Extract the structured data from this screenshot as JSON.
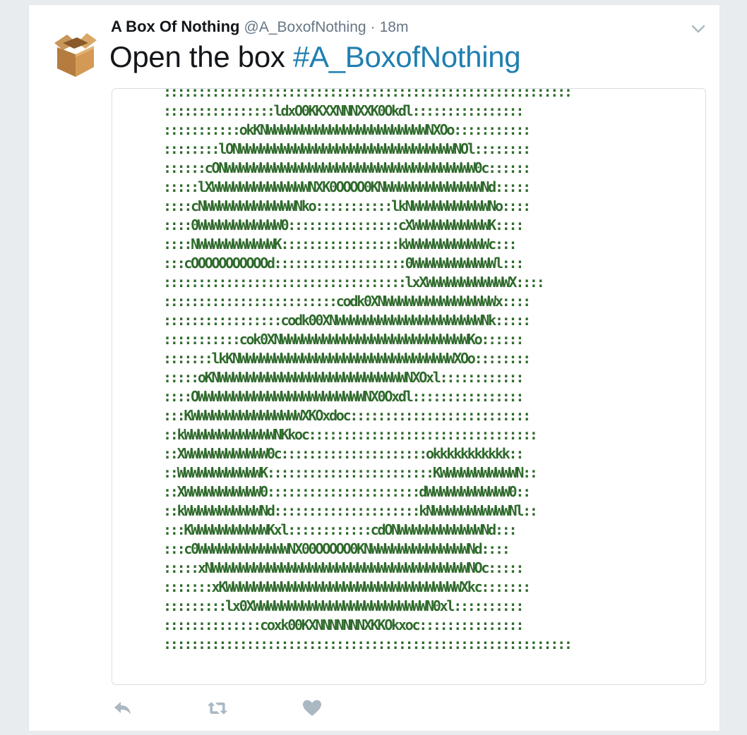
{
  "tweet": {
    "display_name": "A Box Of Nothing",
    "screen_name": "@A_BoxofNothing",
    "separator": "·",
    "timestamp": "18m",
    "text_prefix": "Open the box ",
    "hashtag": "#A_BoxofNothing",
    "ascii_art": ":::::::::::::::::::::::::::::::::::::::::::::::::::::::::::\n::::::::::::::::ldxO0KKXXNNNXXK0Okdl::::::::::::::::\n:::::::::::okKNWWWWWWWWWWWWWWWWWWWWWWWNXOo:::::::::::\n::::::::lONWWWWWWWWWWWWWWWWWWWWWWWWWWWWWWWNOl::::::::\n::::::cONWWWWWWWWWWWWWWWWWWWWWWWWWWWWWWWWWWWW0c::::::\n:::::lXWWWWWWWWWWWWWWNXK0OOOO0KNWWWWWWWWWWWWWWNd:::::\n::::cNWWWWWWWWWWWWWNko:::::::::::lkNWWWWWWWWWWWNo::::\n::::0WWWWWWWWWWWW0::::::::::::::::cXWWWWWWWWWWWK::::\n::::NWWWWWWWWWWWK:::::::::::::::::kWWWWWWWWWWWWc:::\n:::cOOOOOOOOOOOd:::::::::::::::::::0WWWWWWWWWWWWl:::\n:::::::::::::::::::::::::::::::::::lxXWWWWWWWWWWWWX::::\n:::::::::::::::::::::::::codk0XNWWWWWWWWWWWWWWWWx::::\n:::::::::::::::::codk00XNWWWWWWWWWWWWWWWWWWWWWNk:::::\n:::::::::::cok0XNWWWWWWWWWWWWWWWWWWWWWWWWWWWKo::::::\n:::::::lkKNWWWWWWWWWWWWWWWWWWWWWWWWWWWWWWWXOo::::::::\n:::::oKNWWWWWWWWWWWWWWWWWWWWWWWWWWWNXOxl::::::::::::\n::::OWWWWWWWWWWWWWWWWWWWWWWWWNX0Oxdl::::::::::::::::\n:::KWWWWWWWWWWWWWWWWXKOxdoc::::::::::::::::::::::::::\n::kWWWWWWWWWWWWWNKkoc:::::::::::::::::::::::::::::::::\n::XWWWWWWWWWWWW0c:::::::::::::::::::::okkkkkkkkkkk::\n::WWWWWWWWWWWWK::::::::::::::::::::::::KWWWWWWWWWWWN::\n::XWWWWWWWWWWW0::::::::::::::::::::::dWWWWWWWWWWWW0::\n::kWWWWWWWWWWWNd:::::::::::::::::::::kNWWWWWWWWWWWNl::\n:::KWWWWWWWWWWWKxl::::::::::::cdONWWWWWWWWWWWWNd:::\n:::c0WWWWWWWWWWWWWNX00OOOOO0KNWWWWWWWWWWWWWWNd::::\n:::::xNWWWWWWWWWWWWWWWWWWWWWWWWWWWWWWWWWWWWWNOc:::::\n:::::::xKWWWWWWWWWWWWWWWWWWWWWWWWWWWWWWWWWWXkc:::::::\n:::::::::lx0XWWWWWWWWWWWWWWWWWWWWWWWWWN0xl::::::::::\n::::::::::::::coxk00KXNNNNNNNXKKOkxoc:::::::::::::::\n:::::::::::::::::::::::::::::::::::::::::::::::::::::::::::"
  },
  "icons": {
    "avatar": "cardboard-box-icon",
    "caret": "chevron-down-icon",
    "reply": "reply-icon",
    "retweet": "retweet-icon",
    "like": "heart-icon"
  },
  "colors": {
    "hashtag": "#1f7fb0",
    "ascii": "#2f6a2c",
    "action_icon": "#aab8c2"
  }
}
